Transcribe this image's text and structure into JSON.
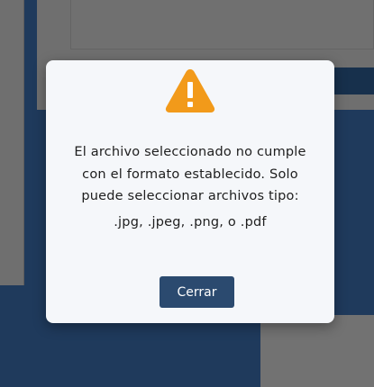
{
  "modal": {
    "icon": "warning-triangle-icon",
    "message_lines": [
      "El archivo seleccionado no cumple",
      "con el formato establecido. Solo",
      "puede seleccionar archivos tipo:",
      ".jpg, .jpeg, .png, o .pdf"
    ],
    "close_label": "Cerrar"
  },
  "colors": {
    "warning": "#f29a1a",
    "button": "#2b4a6f",
    "overlay_bg": "#1f3a5c",
    "modal_bg": "#f5f7fa"
  }
}
